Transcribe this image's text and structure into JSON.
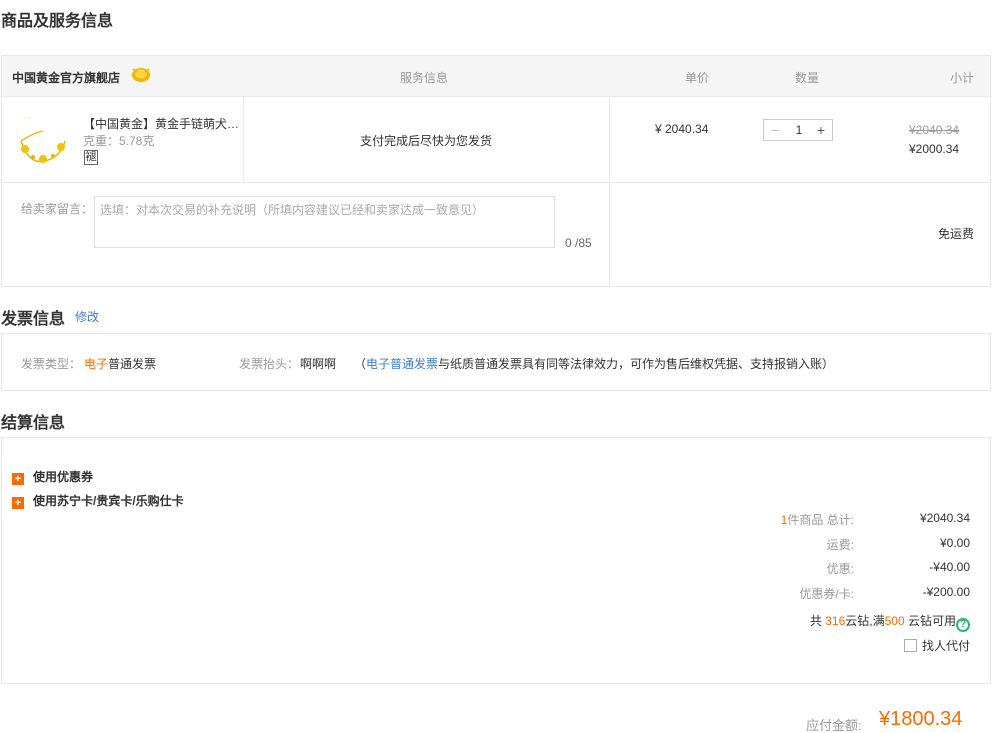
{
  "titles": {
    "goods": "商品及服务信息",
    "invoice": "发票信息",
    "settle": "结算信息",
    "edit": "修改"
  },
  "goods": {
    "store_name": "中国黄金官方旗舰店",
    "columns": {
      "service": "服务信息",
      "price": "单价",
      "qty": "数量",
      "subtotal": "小计"
    },
    "product": {
      "title": "【中国黄金】黄金手链萌犬…",
      "weight": "克重：5.78克",
      "tag": "褪",
      "service": "支付完成后尽快为您发货",
      "unit_price": "¥ 2040.34",
      "qty_minus": "−",
      "qty_value": "1",
      "qty_plus": "+",
      "orig_subtotal": "¥2040.34",
      "final_subtotal": "¥2000.34"
    },
    "memo_label": "给卖家留言：",
    "memo_placeholder": "选填：对本次交易的补充说明（所填内容建议已经和卖家达成一致意见）",
    "memo_count": "0 /85",
    "shipping": "免运费"
  },
  "invoice": {
    "type_label": "发票类型：",
    "type_highlight": "电子",
    "type_rest": "普通发票",
    "head_label": "发票抬头：",
    "head_value": "啊啊啊",
    "note_open": "（",
    "note_link": "电子普通发票",
    "note_rest": "与纸质普通发票具有同等法律效力，可作为售后维权凭据、支持报销入账）"
  },
  "settle": {
    "opt_coupon": "使用优惠券",
    "opt_card": "使用苏宁卡/贵宾卡/乐购仕卡",
    "count_num": "1",
    "count_rest": "件商品 总计:",
    "total": "¥2040.34",
    "freight_label": "运费:",
    "freight": "¥0.00",
    "discount_label": "优惠:",
    "discount": "-¥40.00",
    "coupon_label": "优惠券/卡:",
    "coupon": "-¥200.00",
    "yz_prefix": "共",
    "yz_count": "316",
    "yz_mid": "云钻,满",
    "yz_min": "500",
    "yz_suffix": "云钻可用",
    "help": "?",
    "proxy": "找人代付"
  },
  "pay": {
    "label": "应付金额:",
    "amount": "¥1800.34"
  },
  "colors": {
    "accent": "#ff6a00",
    "link": "#3a7fd5",
    "help": "#2bb673"
  }
}
